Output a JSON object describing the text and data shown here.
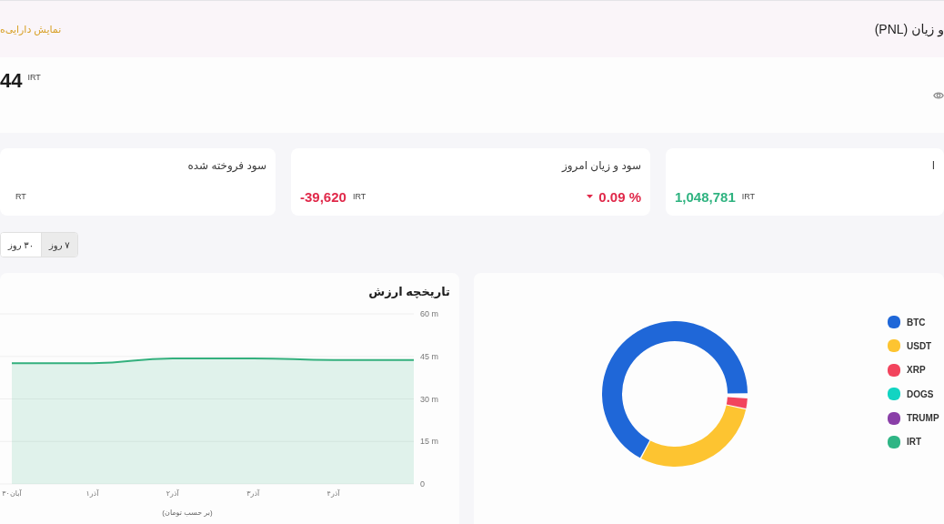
{
  "header": {
    "title": "و زیان (PNL)",
    "assets_link": "نمایش دارایی‌ه"
  },
  "balance": {
    "amount": "44",
    "currency": "IRT"
  },
  "cards": [
    {
      "title": "ا",
      "value": "1,048,781",
      "currency": "IRT",
      "kind": "profit"
    },
    {
      "title": "سود و زیان امروز",
      "value": "-39,620",
      "currency": "IRT",
      "kind": "loss",
      "change": {
        "text": "0.09 %",
        "kind": "down"
      }
    },
    {
      "title": "سود فروخته شده",
      "currency": "RT"
    }
  ],
  "periods": [
    {
      "label": "۷ روز",
      "selected": true
    },
    {
      "label": "۳۰ روز",
      "selected": false
    }
  ],
  "value_history": {
    "title": "تاریخچه ارزش",
    "chart_data": {
      "type": "area",
      "xlabel": "(بر حسب تومان)",
      "categories": [
        "۳۰آبان",
        "۱آذر",
        "۲آذر",
        "۳آذر",
        "۴آذر",
        null
      ],
      "series": [
        {
          "color": "#33b07d",
          "values": [
            42.6,
            42.6,
            44.3,
            44.3,
            43.7,
            43.7
          ]
        }
      ],
      "ylim": [
        0,
        60
      ],
      "grid": true,
      "yticks": [
        {
          "value": 0,
          "label": "0"
        },
        {
          "value": 15,
          "label": "15 m"
        },
        {
          "value": 30,
          "label": "30 m"
        },
        {
          "value": 45,
          "label": "45 m"
        },
        {
          "value": 60,
          "label": "60 m"
        }
      ]
    }
  },
  "allocation": {
    "legend": [
      {
        "label": "BTC",
        "color": "#1f67d8"
      },
      {
        "label": "USDT",
        "color": "#fdc431"
      },
      {
        "label": "XRP",
        "color": "#f2445d"
      },
      {
        "label": "DOGS",
        "color": "#12d4c2"
      },
      {
        "label": "TRUMP",
        "color": "#8a3fa8"
      },
      {
        "label": "IRT",
        "color": "#2fb585"
      }
    ]
  }
}
